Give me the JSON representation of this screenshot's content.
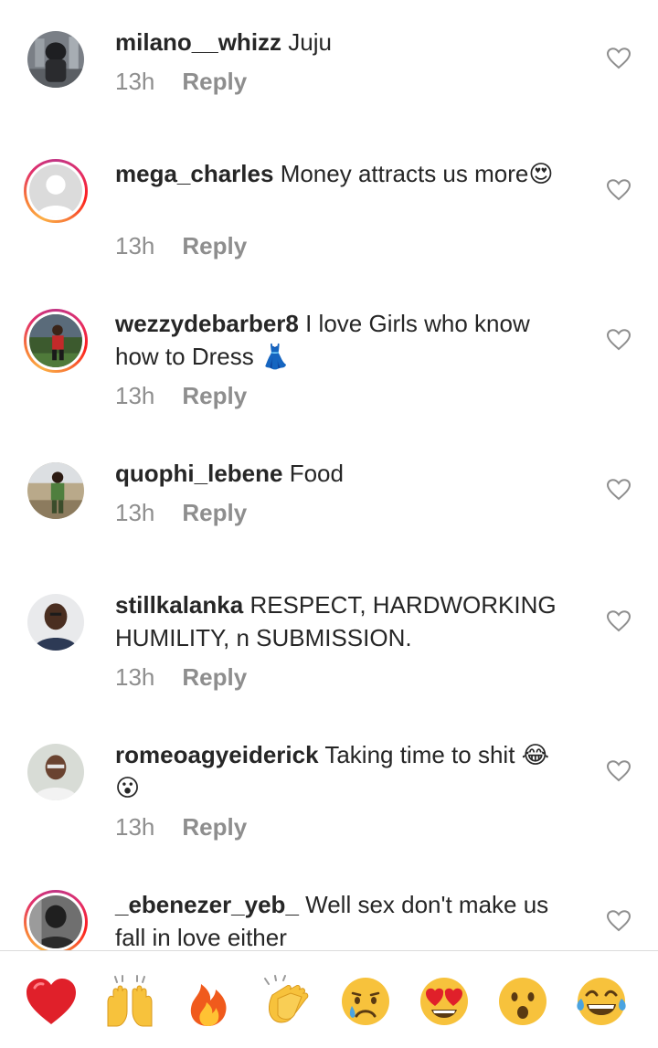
{
  "comments": [
    {
      "username": "milano__whizz",
      "text": "Juju",
      "time": "13h",
      "reply": "Reply"
    },
    {
      "username": "mega_charles",
      "text": "Money attracts us more😍",
      "time": "13h",
      "reply": "Reply"
    },
    {
      "username": "wezzydebarber8",
      "text": "I love Girls who know how to Dress 👗",
      "time": "13h",
      "reply": "Reply"
    },
    {
      "username": "quophi_lebene",
      "text": "Food",
      "time": "13h",
      "reply": "Reply"
    },
    {
      "username": "stillkalanka",
      "text": "RESPECT, HARDWORKING HUMILITY, n SUBMISSION.",
      "time": "13h",
      "reply": "Reply"
    },
    {
      "username": "romeoagyeiderick",
      "text": "Taking time to shit 😂😮",
      "time": "13h",
      "reply": "Reply"
    },
    {
      "username": "_ebenezer_yeb_",
      "text": "Well sex don't make us fall in love either"
    }
  ],
  "reactions": [
    {
      "icon": "red-heart-icon",
      "glyph": "❤️"
    },
    {
      "icon": "raising-hands-icon",
      "glyph": "🙌"
    },
    {
      "icon": "fire-icon",
      "glyph": "🔥"
    },
    {
      "icon": "clapping-hands-icon",
      "glyph": "👏"
    },
    {
      "icon": "crying-face-icon",
      "glyph": "😢"
    },
    {
      "icon": "heart-eyes-icon",
      "glyph": "😍"
    },
    {
      "icon": "surprised-face-icon",
      "glyph": "😮"
    },
    {
      "icon": "laughing-tears-icon",
      "glyph": "😂"
    }
  ],
  "colors": {
    "text": "#262626",
    "meta": "#8e8e8e",
    "story_ring_start": "#c13584",
    "story_ring_end": "#fcaf45"
  }
}
